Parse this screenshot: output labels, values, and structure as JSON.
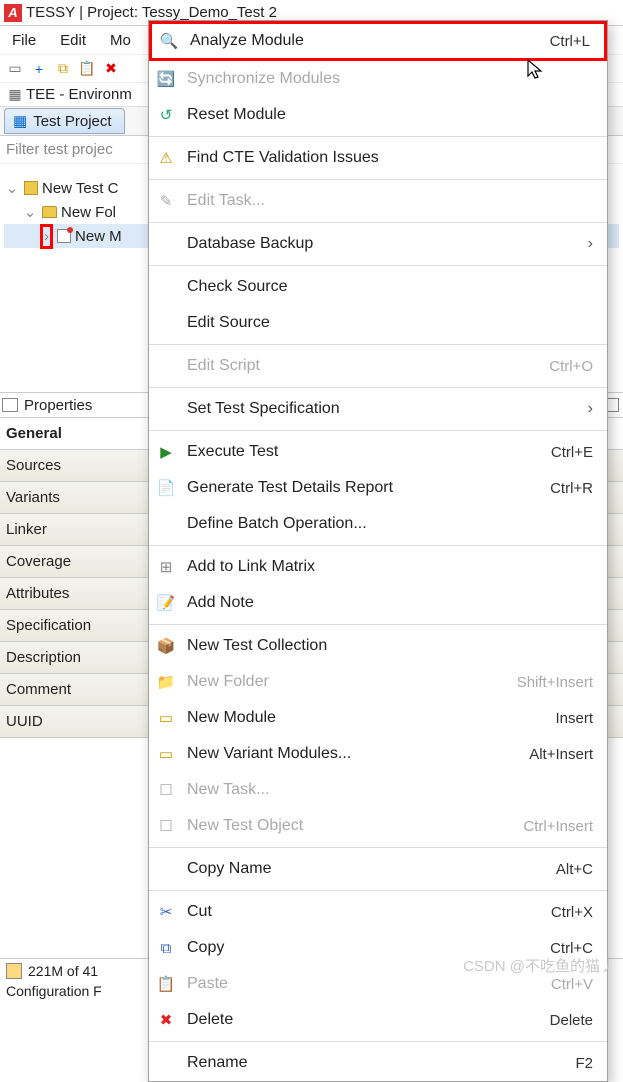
{
  "title": "TESSY | Project: Tessy_Demo_Test 2",
  "menubar": {
    "file": "File",
    "edit": "Edit",
    "more": "Mo"
  },
  "tab_env": "TEE - Environm",
  "tab_project": "Test Project",
  "filter_placeholder": "Filter test projec",
  "tree": {
    "coll": "New Test C",
    "folder": "New Fol",
    "module": "New M"
  },
  "properties_title": "Properties",
  "prop_general": "General",
  "props": [
    "Sources",
    "Variants",
    "Linker",
    "Coverage",
    "Attributes",
    "Specification",
    "Description",
    "Comment",
    "UUID"
  ],
  "status_mem": "221M of 41",
  "status_cfg": "Configuration F",
  "watermark": "CSDN @不吃鱼的猫丿",
  "menu": [
    {
      "icon": "magnify",
      "label": "Analyze Module",
      "sc": "Ctrl+L",
      "hl": true
    },
    {
      "icon": "sync",
      "label": "Synchronize Modules",
      "disabled": true
    },
    {
      "icon": "reset",
      "label": "Reset Module"
    },
    {
      "sep": true
    },
    {
      "icon": "cte",
      "label": "Find CTE Validation Issues"
    },
    {
      "sep": true
    },
    {
      "icon": "edit",
      "label": "Edit Task...",
      "disabled": true
    },
    {
      "sep": true
    },
    {
      "label": "Database Backup",
      "submenu": true
    },
    {
      "sep": true
    },
    {
      "label": "Check Source"
    },
    {
      "label": "Edit Source"
    },
    {
      "sep": true
    },
    {
      "label": "Edit Script",
      "sc": "Ctrl+O",
      "disabled": true
    },
    {
      "sep": true
    },
    {
      "label": "Set Test Specification",
      "submenu": true
    },
    {
      "sep": true
    },
    {
      "icon": "play",
      "label": "Execute Test",
      "sc": "Ctrl+E"
    },
    {
      "icon": "report",
      "label": "Generate Test Details Report",
      "sc": "Ctrl+R"
    },
    {
      "label": "Define Batch Operation..."
    },
    {
      "sep": true
    },
    {
      "icon": "linkm",
      "label": "Add to Link Matrix"
    },
    {
      "icon": "note",
      "label": "Add Note"
    },
    {
      "sep": true
    },
    {
      "icon": "coll",
      "label": "New Test Collection"
    },
    {
      "icon": "nfold",
      "label": "New Folder",
      "sc": "Shift+Insert",
      "disabled": true
    },
    {
      "icon": "nmod",
      "label": "New Module",
      "sc": "Insert"
    },
    {
      "icon": "nvar",
      "label": "New Variant Modules...",
      "sc": "Alt+Insert"
    },
    {
      "icon": "ntask",
      "label": "New Task...",
      "disabled": true
    },
    {
      "icon": "nobj",
      "label": "New Test Object",
      "sc": "Ctrl+Insert",
      "disabled": true
    },
    {
      "sep": true
    },
    {
      "label": "Copy Name",
      "sc": "Alt+C"
    },
    {
      "sep": true
    },
    {
      "icon": "cut",
      "label": "Cut",
      "sc": "Ctrl+X"
    },
    {
      "icon": "copy",
      "label": "Copy",
      "sc": "Ctrl+C"
    },
    {
      "icon": "paste",
      "label": "Paste",
      "sc": "Ctrl+V",
      "disabled": true
    },
    {
      "icon": "del",
      "label": "Delete",
      "sc": "Delete"
    },
    {
      "sep": true
    },
    {
      "label": "Rename",
      "sc": "F2"
    }
  ],
  "icons": {
    "magnify": "🔍",
    "sync": "🔄",
    "reset": "↺",
    "cte": "⚠",
    "edit": "✎",
    "play": "▶",
    "report": "📄",
    "linkm": "⊞",
    "note": "📝",
    "coll": "📦",
    "nfold": "📁",
    "nmod": "▭",
    "nvar": "▭",
    "ntask": "☐",
    "nobj": "☐",
    "cut": "✂",
    "copy": "⧉",
    "paste": "📋",
    "del": "✖"
  },
  "iconColors": {
    "magnify": "#c79a00",
    "sync": "#999",
    "reset": "#2a7",
    "cte": "#c79a00",
    "edit": "#999",
    "play": "#2a8a2a",
    "report": "#2a8a2a",
    "linkm": "#888",
    "note": "#c79a00",
    "coll": "#c79a00",
    "nfold": "#999",
    "nmod": "#c79a00",
    "nvar": "#c79a00",
    "ntask": "#999",
    "nobj": "#999",
    "cut": "#36c",
    "copy": "#36c",
    "paste": "#999",
    "del": "#d22"
  }
}
